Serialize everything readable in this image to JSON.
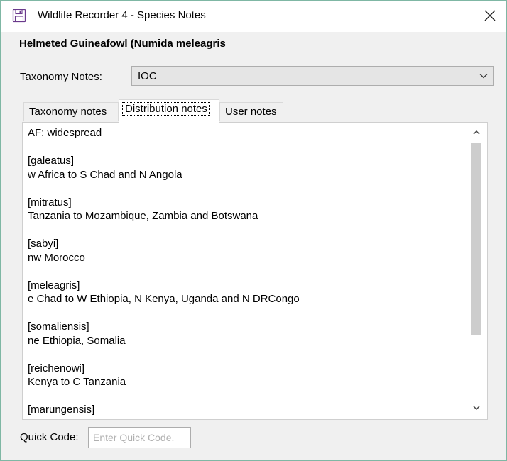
{
  "window": {
    "title": "Wildlife Recorder 4 - Species Notes"
  },
  "species": {
    "name": "Helmeted Guineafowl (Numida meleagris"
  },
  "taxonomy": {
    "label": "Taxonomy Notes:",
    "selected": "IOC"
  },
  "tabs": [
    {
      "label": "Taxonomy notes",
      "active": false
    },
    {
      "label": "Distribution notes",
      "active": true
    },
    {
      "label": "User notes",
      "active": false
    }
  ],
  "notes_lines": [
    "AF: widespread",
    "",
    "[galeatus]",
    "w Africa to S Chad and N Angola",
    "",
    "[mitratus]",
    "Tanzania to Mozambique, Zambia and Botswana",
    "",
    "[sabyi]",
    "nw Morocco",
    "",
    "[meleagris]",
    "e Chad to W Ethiopia, N Kenya, Uganda and N DRCongo",
    "",
    "[somaliensis]",
    "ne Ethiopia, Somalia",
    "",
    "[reichenowi]",
    "Kenya to C Tanzania",
    "",
    "[marungensis]"
  ],
  "quick_code": {
    "label": "Quick Code:",
    "placeholder": "Enter Quick Code.",
    "value": ""
  }
}
